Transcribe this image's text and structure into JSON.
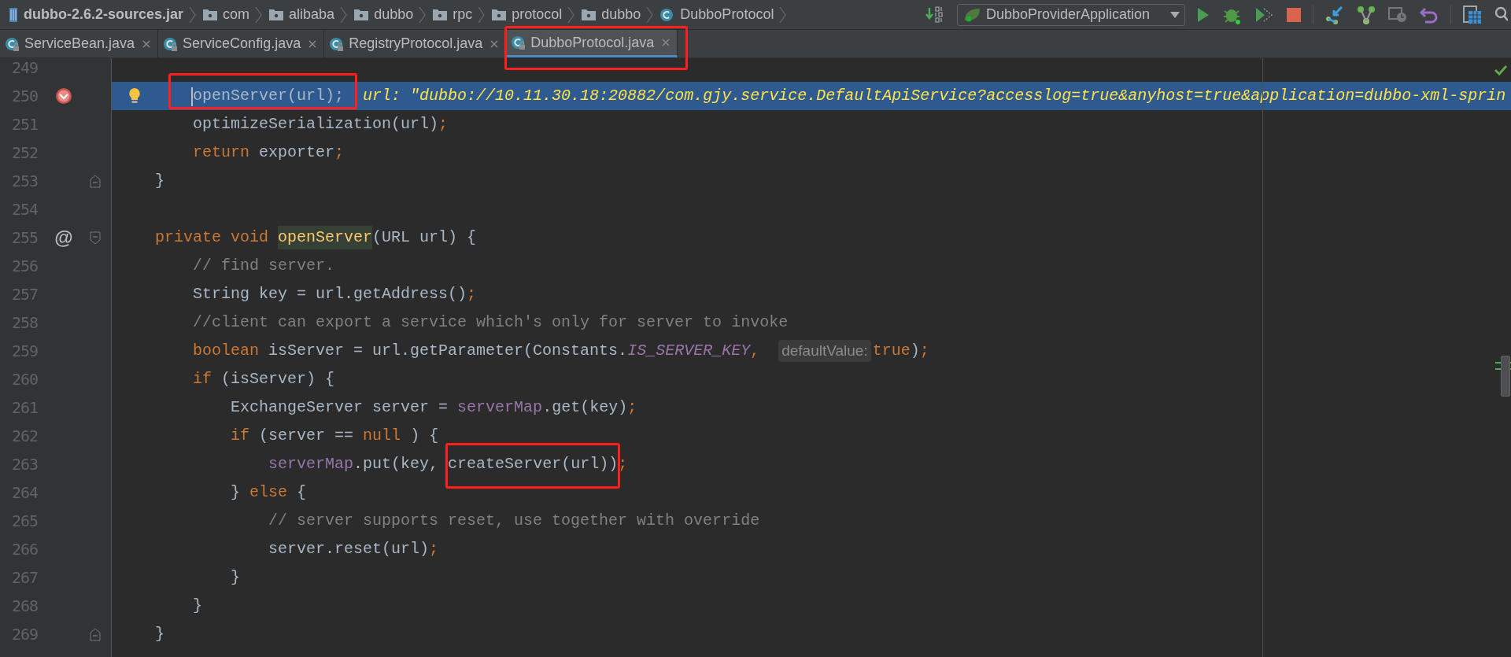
{
  "breadcrumbs": [
    {
      "label": "dubbo-2.6.2-sources.jar",
      "kind": "jar"
    },
    {
      "label": "com",
      "kind": "folder"
    },
    {
      "label": "alibaba",
      "kind": "folder"
    },
    {
      "label": "dubbo",
      "kind": "folder"
    },
    {
      "label": "rpc",
      "kind": "folder"
    },
    {
      "label": "protocol",
      "kind": "folder"
    },
    {
      "label": "dubbo",
      "kind": "folder"
    },
    {
      "label": "DubboProtocol",
      "kind": "class"
    }
  ],
  "run_config": {
    "label": "DubboProviderApplication"
  },
  "tabs": [
    {
      "label": "ServiceBean.java",
      "selected": false,
      "annotated": false
    },
    {
      "label": "ServiceConfig.java",
      "selected": false,
      "annotated": false
    },
    {
      "label": "RegistryProtocol.java",
      "selected": false,
      "annotated": false
    },
    {
      "label": "DubboProtocol.java",
      "selected": true,
      "annotated": true
    }
  ],
  "editor": {
    "lines": [
      {
        "number": "249"
      },
      {
        "number": "250",
        "current": true,
        "breakpoint": true,
        "intention": true,
        "tokens": [
          {
            "text": "        openServer(url);",
            "kind": "plain",
            "annotated": true
          },
          {
            "text": "  url: \"dubbo://10.11.30.18:20882/com.gjy.service.DefaultApiService?accesslog=true&anyhost=true&application=dubbo-xml-sprin",
            "kind": "debug"
          }
        ]
      },
      {
        "number": "251",
        "tokens": [
          {
            "text": "        optimizeSerialization(url)",
            "kind": "plain"
          },
          {
            "text": ";",
            "kind": "keyword"
          }
        ]
      },
      {
        "number": "252",
        "tokens": [
          {
            "text": "        return",
            "kind": "keyword"
          },
          {
            "text": " exporter",
            "kind": "plain"
          },
          {
            "text": ";",
            "kind": "keyword"
          }
        ]
      },
      {
        "number": "253",
        "fold_end": true,
        "tokens": [
          {
            "text": "    }",
            "kind": "plain"
          }
        ]
      },
      {
        "number": "254"
      },
      {
        "number": "255",
        "override_mark": "@",
        "fold_start": true,
        "tokens": [
          {
            "text": "    private void ",
            "kind": "keyword"
          },
          {
            "text": "openServer",
            "kind": "usage"
          },
          {
            "text": "(URL url) {",
            "kind": "plain"
          }
        ]
      },
      {
        "number": "256",
        "tokens": [
          {
            "text": "        // find server.",
            "kind": "comment"
          }
        ]
      },
      {
        "number": "257",
        "tokens": [
          {
            "text": "        String key = url.getAddress()",
            "kind": "plain"
          },
          {
            "text": ";",
            "kind": "keyword"
          }
        ]
      },
      {
        "number": "258",
        "tokens": [
          {
            "text": "        //client can export a service which's only for server to invoke",
            "kind": "comment"
          }
        ]
      },
      {
        "number": "259",
        "tokens": [
          {
            "text": "        boolean ",
            "kind": "keyword"
          },
          {
            "text": "isServer = url.getParameter(Constants.",
            "kind": "plain"
          },
          {
            "text": "IS_SERVER_KEY",
            "kind": "constant"
          },
          {
            "text": ",  ",
            "kind": "keyword"
          },
          {
            "text": "defaultValue:",
            "kind": "hint"
          },
          {
            "text": "true",
            "kind": "keyword"
          },
          {
            "text": ")",
            "kind": "plain"
          },
          {
            "text": ";",
            "kind": "keyword"
          }
        ]
      },
      {
        "number": "260",
        "tokens": [
          {
            "text": "        if ",
            "kind": "keyword"
          },
          {
            "text": "(isServer) {",
            "kind": "plain"
          }
        ]
      },
      {
        "number": "261",
        "tokens": [
          {
            "text": "            ExchangeServer server = ",
            "kind": "plain"
          },
          {
            "text": "serverMap",
            "kind": "field"
          },
          {
            "text": ".get(key)",
            "kind": "plain"
          },
          {
            "text": ";",
            "kind": "keyword"
          }
        ]
      },
      {
        "number": "262",
        "tokens": [
          {
            "text": "            if ",
            "kind": "keyword"
          },
          {
            "text": "(server == ",
            "kind": "plain"
          },
          {
            "text": "null ",
            "kind": "keyword"
          },
          {
            "text": ") {",
            "kind": "plain"
          }
        ]
      },
      {
        "number": "263",
        "tokens": [
          {
            "text": "                serverMap",
            "kind": "field"
          },
          {
            "text": ".put(key, ",
            "kind": "plain"
          },
          {
            "text": "createServer(url))",
            "kind": "plain",
            "annotated": true
          },
          {
            "text": ";",
            "kind": "keyword"
          }
        ]
      },
      {
        "number": "264",
        "tokens": [
          {
            "text": "            } ",
            "kind": "plain"
          },
          {
            "text": "else ",
            "kind": "keyword"
          },
          {
            "text": "{",
            "kind": "plain"
          }
        ]
      },
      {
        "number": "265",
        "tokens": [
          {
            "text": "                // server supports reset, use together with override",
            "kind": "comment"
          }
        ]
      },
      {
        "number": "266",
        "tokens": [
          {
            "text": "                server.reset(url)",
            "kind": "plain"
          },
          {
            "text": ";",
            "kind": "keyword"
          }
        ]
      },
      {
        "number": "267",
        "tokens": [
          {
            "text": "            }",
            "kind": "plain"
          }
        ]
      },
      {
        "number": "268",
        "tokens": [
          {
            "text": "        }",
            "kind": "plain"
          }
        ]
      },
      {
        "number": "269",
        "fold_end": true,
        "tokens": [
          {
            "text": "    }",
            "kind": "plain"
          }
        ]
      }
    ]
  }
}
